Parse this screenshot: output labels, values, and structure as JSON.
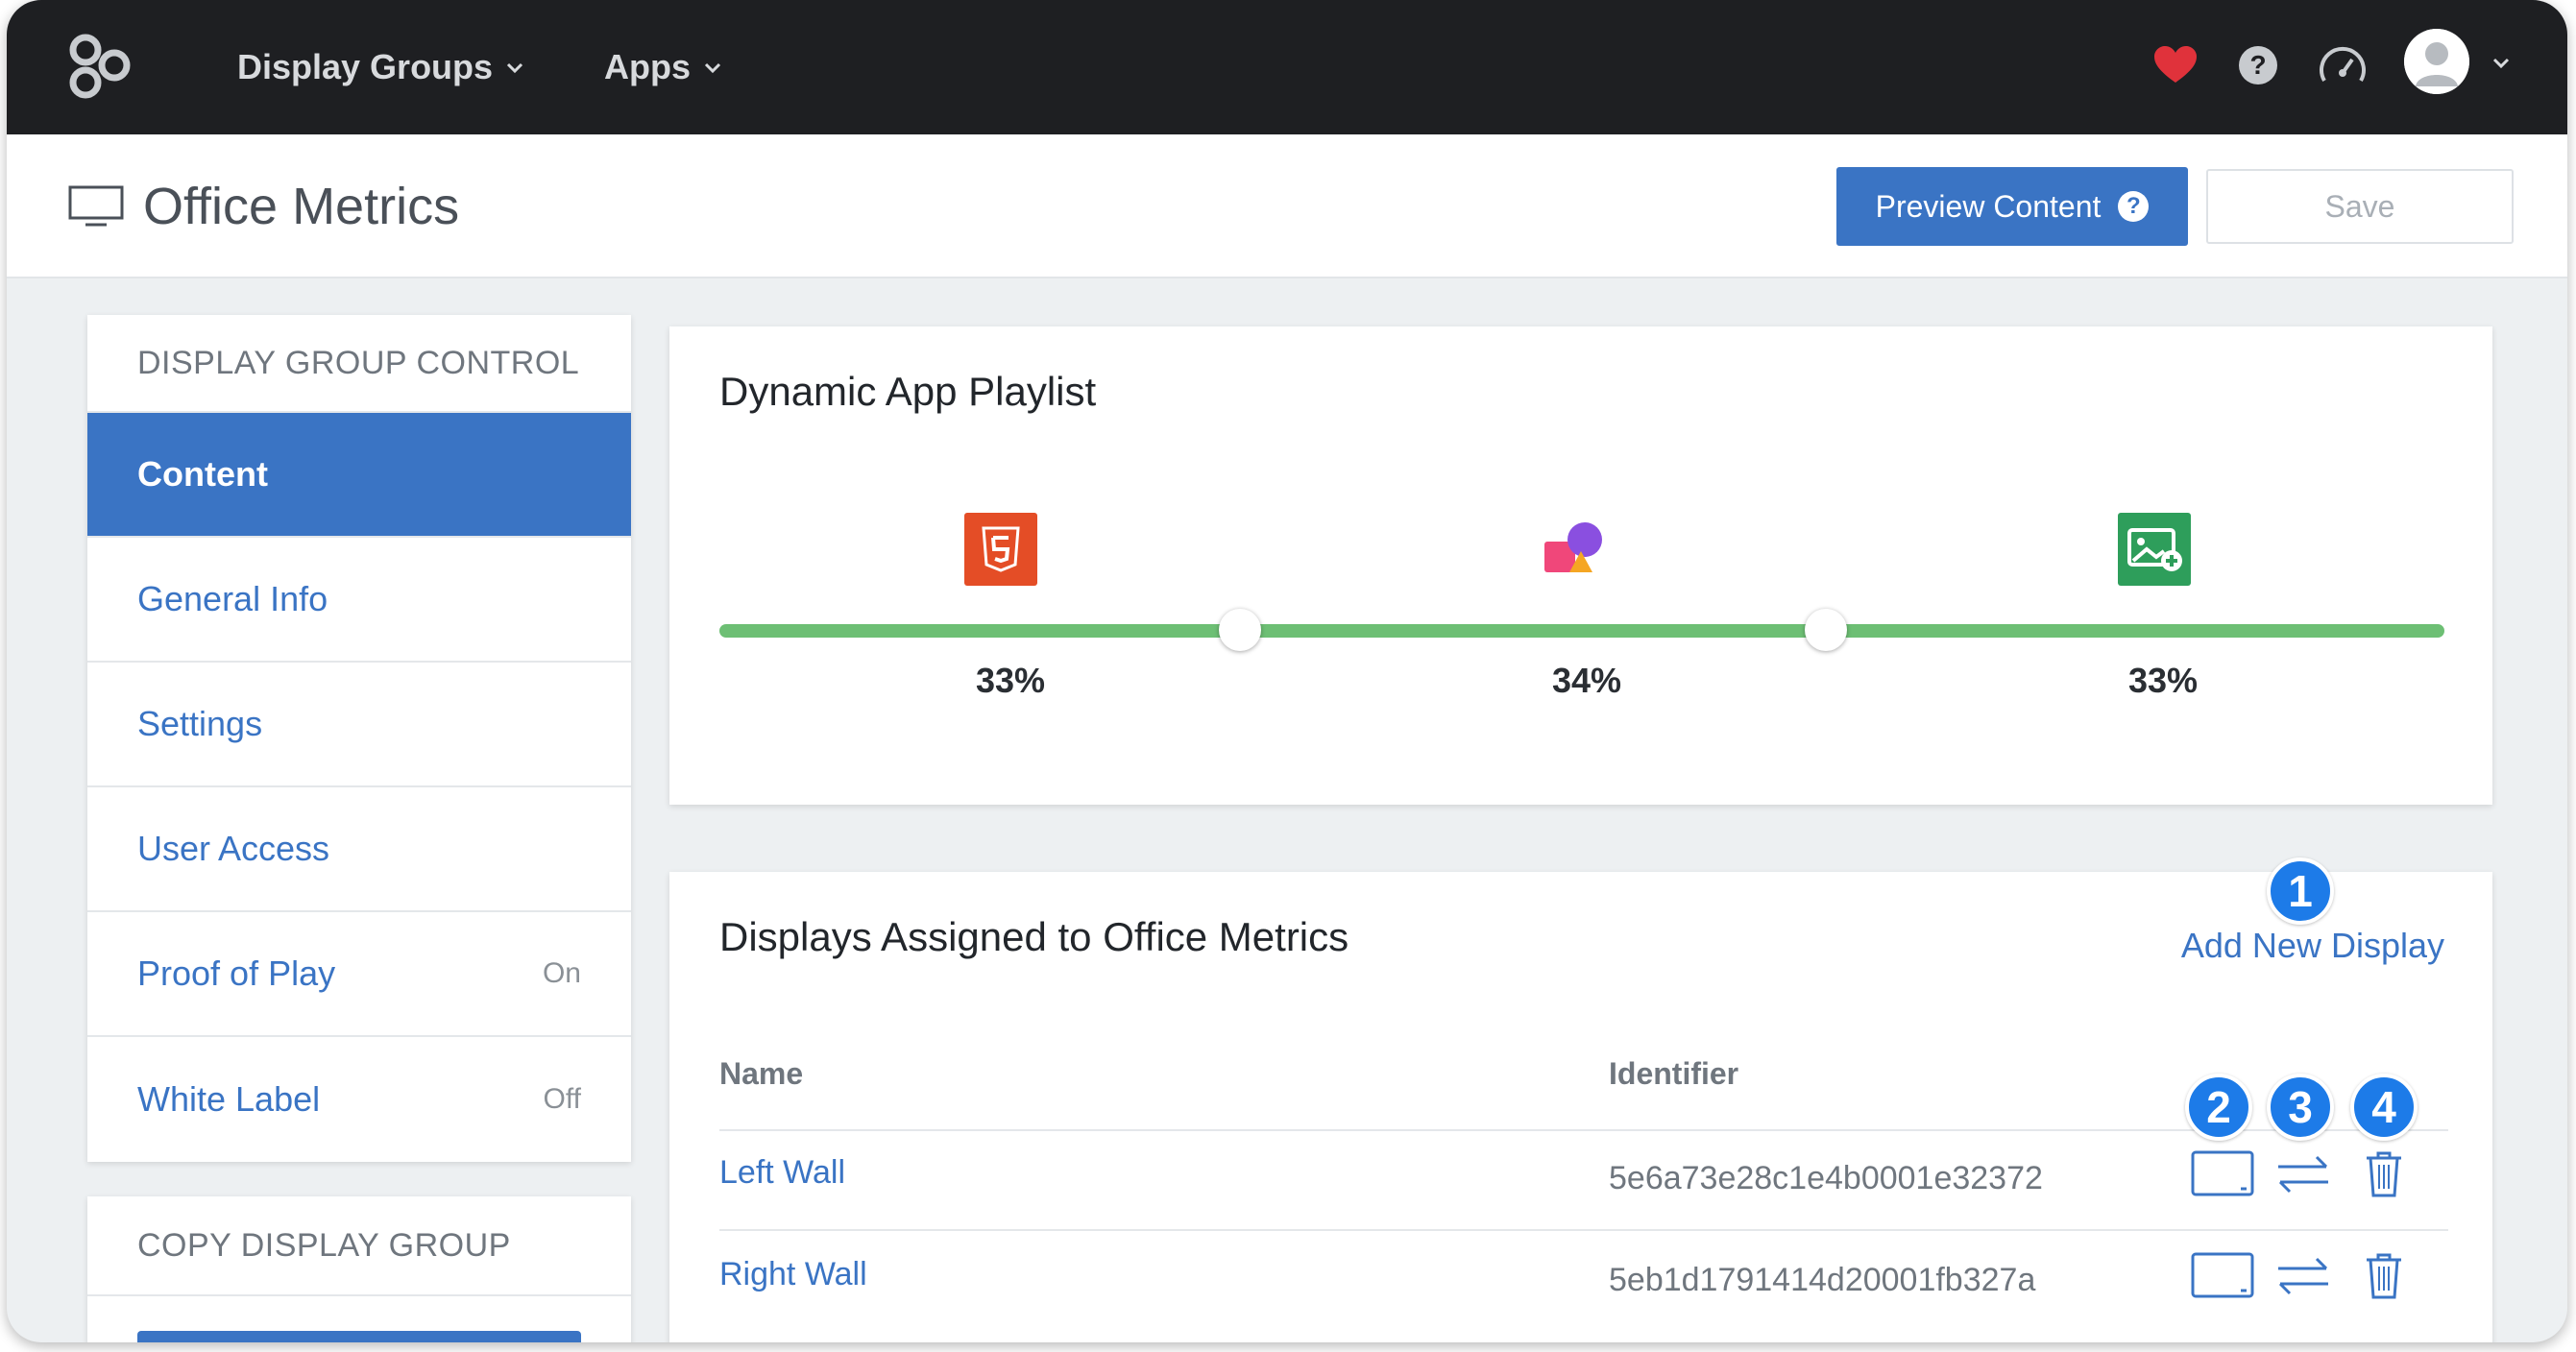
{
  "topnav": {
    "menus": [
      {
        "label": "Display Groups"
      },
      {
        "label": "Apps"
      }
    ],
    "icons": [
      "logo-icon",
      "heart-icon",
      "help-icon",
      "speedometer-icon",
      "avatar"
    ]
  },
  "header": {
    "title": "Office Metrics",
    "preview_label": "Preview Content",
    "save_label": "Save"
  },
  "sidebar": {
    "section_title": "DISPLAY GROUP CONTROL",
    "items": [
      {
        "label": "Content",
        "active": true
      },
      {
        "label": "General Info"
      },
      {
        "label": "Settings"
      },
      {
        "label": "User Access"
      },
      {
        "label": "Proof of Play",
        "status": "On"
      },
      {
        "label": "White Label",
        "status": "Off"
      }
    ],
    "section2_title": "COPY DISPLAY GROUP"
  },
  "playlist": {
    "title": "Dynamic App Playlist",
    "segments": [
      {
        "app": "html5-icon",
        "percent": "33%"
      },
      {
        "app": "shapes-app-icon",
        "percent": "34%"
      },
      {
        "app": "image-app-icon",
        "percent": "33%"
      }
    ]
  },
  "displays": {
    "title": "Displays Assigned to Office Metrics",
    "add_label": "Add New Display",
    "columns": {
      "name": "Name",
      "identifier": "Identifier"
    },
    "rows": [
      {
        "name": "Left Wall",
        "identifier": "5e6a73e28c1e4b0001e32372"
      },
      {
        "name": "Right Wall",
        "identifier": "5eb1d1791414d20001fb327a"
      }
    ]
  },
  "callouts": [
    "1",
    "2",
    "3",
    "4"
  ],
  "colors": {
    "nav_bg": "#1e1f22",
    "accent": "#3a74c4",
    "slider": "#6dbf74",
    "callout": "#1d7be8"
  }
}
